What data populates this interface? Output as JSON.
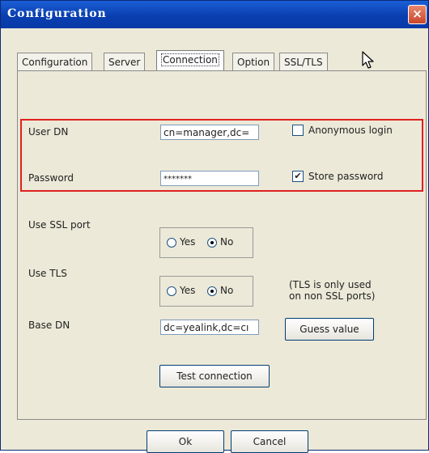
{
  "window": {
    "title": "Configuration",
    "close_glyph": "×"
  },
  "tabs": [
    {
      "label": "Configuration",
      "active": false
    },
    {
      "label": "Server",
      "active": false
    },
    {
      "label": "Connection",
      "active": true
    },
    {
      "label": "Option",
      "active": false
    },
    {
      "label": "SSL/TLS",
      "active": false
    }
  ],
  "form": {
    "user_dn": {
      "label": "User DN",
      "value": "cn=manager,dc="
    },
    "anonymous_login": {
      "label": "Anonymous login",
      "checked": false
    },
    "password": {
      "label": "Password",
      "value": "*******"
    },
    "store_password": {
      "label": "Store password",
      "checked": true,
      "glyph": "✔"
    },
    "use_ssl_port": {
      "label": "Use SSL port",
      "yes_label": "Yes",
      "no_label": "No",
      "selected": "No"
    },
    "use_tls": {
      "label": "Use TLS",
      "yes_label": "Yes",
      "no_label": "No",
      "selected": "No",
      "note_line1": "(TLS is only used",
      "note_line2": "on non SSL ports)"
    },
    "base_dn": {
      "label": "Base DN",
      "value": "dc=yealink,dc=cı"
    },
    "guess_value_button": "Guess value",
    "test_connection_button": "Test connection"
  },
  "footer": {
    "ok_button": "Ok",
    "cancel_button": "Cancel"
  },
  "colors": {
    "titlebar": "#0a3fb0",
    "highlight": "#e02020",
    "dialog_bg": "#ece9d8"
  },
  "icons": {
    "cursor": "mouse-pointer-icon",
    "close": "close-icon"
  }
}
